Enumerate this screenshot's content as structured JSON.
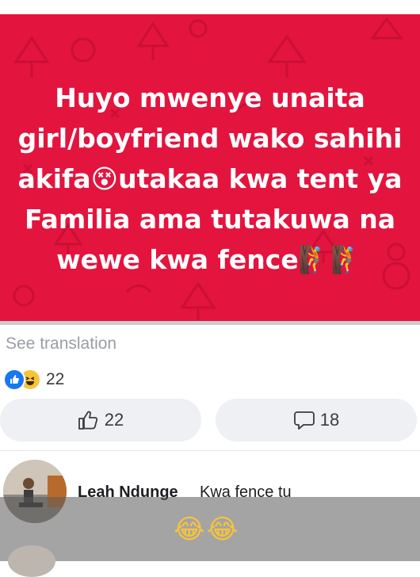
{
  "post": {
    "background_color": "#e3143e",
    "text_line1": "Huyo mwenye unaita",
    "text_line2": "girl/boyfriend wako sahihi",
    "text_line3a": "akifa",
    "emoji_dizzy": "😵",
    "text_line3b": "utakaa kwa tent ya",
    "text_line4": "Familia ama tutakuwa na",
    "text_line5": "wewe kwa fence",
    "emoji_climb": "🧗🧗"
  },
  "see_translation": "See translation",
  "reactions": {
    "icons": [
      "like-icon",
      "haha-icon"
    ],
    "count": "22"
  },
  "actions": {
    "like_count": "22",
    "comment_count": "18"
  },
  "comment": {
    "author": "Leah Ndunge",
    "text": "Kwa fence tu",
    "emoji": "😂😂"
  },
  "colors": {
    "like_blue": "#1877f2",
    "haha_yellow": "#f7c33b",
    "button_bg": "#eef0f3"
  }
}
